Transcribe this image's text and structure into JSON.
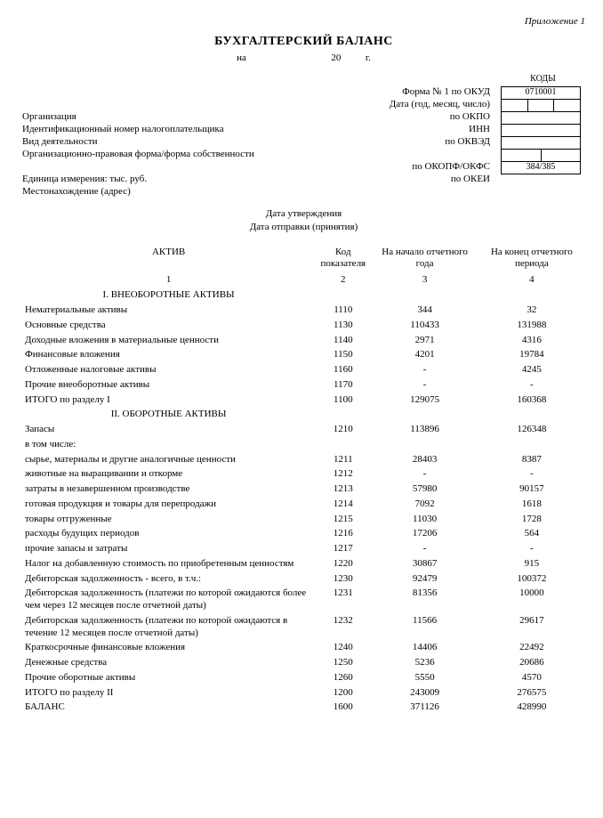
{
  "attachment": "Приложение 1",
  "title": "БУХГАЛТЕРСКИЙ БАЛАНС",
  "date_line": {
    "prefix": "на",
    "mid": "20",
    "suffix": "г."
  },
  "header": {
    "kody_label": "КОДЫ",
    "right_labels": {
      "form": "Форма № 1 по ОКУД",
      "date": "Дата (год, месяц, число)",
      "okpo": "по ОКПО",
      "inn_suffix": "ИНН",
      "okved": "по ОКВЭД",
      "okopf": "по ОКОПФ/ОКФС",
      "okei": "по ОКЕИ"
    },
    "left_labels": {
      "org": "Организация",
      "inn": "Идентификационный номер налогоплательщика",
      "activity": "Вид деятельности",
      "form_own": "Организационно-правовая форма/форма собственности",
      "unit": "Единица измерения: тыс. руб.",
      "address": "Местонахождение (адрес)"
    },
    "box_values": {
      "okud": "0710001",
      "okei": "384/385"
    }
  },
  "two_line": {
    "l1": "Дата утверждения",
    "l2": "Дата отправки (принятия)"
  },
  "columns": {
    "c1": "АКТИВ",
    "c2": "Код показателя",
    "c3": "На начало отчетного года",
    "c4": "На конец отчетного периода",
    "n1": "1",
    "n2": "2",
    "n3": "3",
    "n4": "4"
  },
  "sections": {
    "s1_title": "I. ВНЕОБОРОТНЫЕ АКТИВЫ",
    "s1": [
      {
        "name": "Нематериальные активы",
        "code": "1110",
        "v1": "344",
        "v2": "32"
      },
      {
        "name": "Основные средства",
        "code": "1130",
        "v1": "110433",
        "v2": "131988"
      },
      {
        "name": "Доходные вложения в материальные ценности",
        "code": "1140",
        "v1": "2971",
        "v2": "4316"
      },
      {
        "name": "Финансовые вложения",
        "code": "1150",
        "v1": "4201",
        "v2": "19784"
      },
      {
        "name": "Отложенные налоговые активы",
        "code": "1160",
        "v1": "-",
        "v2": "4245"
      },
      {
        "name": "Прочие внеоборотные активы",
        "code": "1170",
        "v1": "-",
        "v2": "-"
      },
      {
        "name": "ИТОГО по разделу I",
        "code": "1100",
        "v1": "129075",
        "v2": "160368",
        "indent": 1
      }
    ],
    "s2_title": "II. ОБОРОТНЫЕ АКТИВЫ",
    "s2": [
      {
        "name": "Запасы",
        "code": "1210",
        "v1": "113896",
        "v2": "126348"
      },
      {
        "name": "в том числе:",
        "code": "",
        "v1": "",
        "v2": "",
        "indent": 1
      },
      {
        "name": "сырье, материалы и другие аналогичные ценности",
        "code": "1211",
        "v1": "28403",
        "v2": "8387",
        "indent": 1
      },
      {
        "name": "животные на выращивании и откорме",
        "code": "1212",
        "v1": "-",
        "v2": "-",
        "indent": 1
      },
      {
        "name": "затраты в незавершенном производстве",
        "code": "1213",
        "v1": "57980",
        "v2": "90157",
        "indent": 1
      },
      {
        "name": "готовая продукция и товары для перепродажи",
        "code": "1214",
        "v1": "7092",
        "v2": "1618",
        "indent": 1
      },
      {
        "name": "товары отгруженные",
        "code": "1215",
        "v1": "11030",
        "v2": "1728",
        "indent": 1
      },
      {
        "name": "расходы будущих периодов",
        "code": "1216",
        "v1": "17206",
        "v2": "564",
        "indent": 1
      },
      {
        "name": "прочие запасы и затраты",
        "code": "1217",
        "v1": "-",
        "v2": "-",
        "indent": 1
      },
      {
        "name": "Налог на добавленную стоимость по приобретенным ценностям",
        "code": "1220",
        "v1": "30867",
        "v2": "915"
      },
      {
        "name": "Дебиторская задолженность - всего, в т.ч.:",
        "code": "1230",
        "v1": "92479",
        "v2": "100372"
      },
      {
        "name": "Дебиторская задолженность (платежи по которой ожидаются более чем через 12 месяцев после отчетной даты)",
        "code": "1231",
        "v1": "81356",
        "v2": "10000"
      },
      {
        "name": "Дебиторская задолженность (платежи по которой ожидаются в течение 12 месяцев после отчетной даты)",
        "code": "1232",
        "v1": "11566",
        "v2": "29617"
      },
      {
        "name": "Краткосрочные финансовые вложения",
        "code": "1240",
        "v1": "14406",
        "v2": "22492"
      },
      {
        "name": "Денежные средства",
        "code": "1250",
        "v1": "5236",
        "v2": "20686"
      },
      {
        "name": "Прочие оборотные активы",
        "code": "1260",
        "v1": "5550",
        "v2": "4570"
      },
      {
        "name": "ИТОГО по разделу II",
        "code": "1200",
        "v1": "243009",
        "v2": "276575",
        "indent": 1
      },
      {
        "name": "БАЛАНС",
        "code": "1600",
        "v1": "371126",
        "v2": "428990",
        "indent": 2
      }
    ]
  }
}
